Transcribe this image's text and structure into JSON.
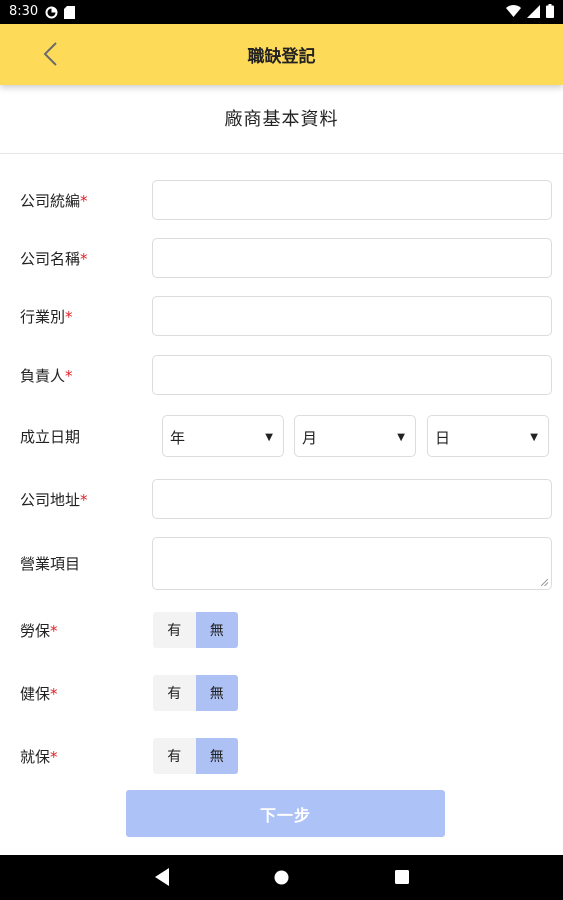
{
  "status_bar": {
    "time": "8:30"
  },
  "app_bar": {
    "title": "職缺登記"
  },
  "section": {
    "title": "廠商基本資料"
  },
  "form": {
    "tax_id": {
      "label": "公司統編",
      "required_mark": "*",
      "value": ""
    },
    "company_name": {
      "label": "公司名稱",
      "required_mark": "*",
      "value": ""
    },
    "industry": {
      "label": "行業別",
      "required_mark": "*",
      "value": ""
    },
    "owner": {
      "label": "負責人",
      "required_mark": "*",
      "value": ""
    },
    "founded_date": {
      "label": "成立日期",
      "year": "年",
      "month": "月",
      "day": "日"
    },
    "address": {
      "label": "公司地址",
      "required_mark": "*",
      "value": ""
    },
    "business_items": {
      "label": "營業項目",
      "value": ""
    },
    "labor_insurance": {
      "label": "勞保",
      "required_mark": "*",
      "option_yes": "有",
      "option_no": "無",
      "selected": "無"
    },
    "health_insurance": {
      "label": "健保",
      "required_mark": "*",
      "option_yes": "有",
      "option_no": "無",
      "selected": "無"
    },
    "employment_insurance": {
      "label": "就保",
      "required_mark": "*",
      "option_yes": "有",
      "option_no": "無",
      "selected": "無"
    }
  },
  "next_button": {
    "label": "下一步"
  },
  "colors": {
    "app_bar": "#fddb58",
    "accent_selected": "#aec1f5",
    "required": "#e0202a",
    "next_button": "#adc2f7"
  },
  "icons": {
    "back": "chevron-left-icon",
    "nav_back": "triangle-back-icon",
    "nav_home": "circle-home-icon",
    "nav_recents": "square-recents-icon"
  }
}
